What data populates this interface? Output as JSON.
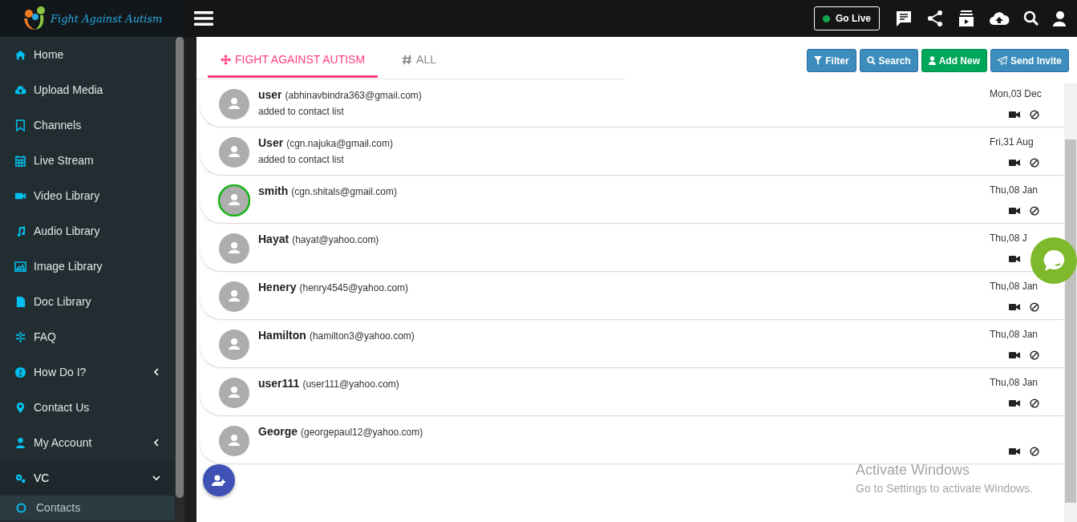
{
  "brand": {
    "name": "Fight Against Autism"
  },
  "header": {
    "go_live": "Go Live"
  },
  "sidebar": {
    "items": [
      {
        "label": "Home",
        "selected": false
      },
      {
        "label": "Upload Media",
        "selected": false
      },
      {
        "label": "Channels",
        "selected": false
      },
      {
        "label": "Live Stream",
        "selected": false
      },
      {
        "label": "Video Library",
        "selected": false
      },
      {
        "label": "Audio Library",
        "selected": false
      },
      {
        "label": "Image Library",
        "selected": false
      },
      {
        "label": "Doc Library",
        "selected": false
      },
      {
        "label": "FAQ",
        "selected": false
      },
      {
        "label": "How Do I?",
        "selected": false,
        "expanded": false
      },
      {
        "label": "Contact Us",
        "selected": false
      },
      {
        "label": "My Account",
        "selected": false,
        "expanded": false
      },
      {
        "label": "VC",
        "selected": true,
        "expanded": true,
        "children": [
          {
            "label": "Contacts",
            "selected": true
          }
        ]
      }
    ]
  },
  "tabs": [
    {
      "label": "FIGHT AGAINST AUTISM",
      "selected": true
    },
    {
      "label": "ALL",
      "selected": false
    }
  ],
  "buttons": [
    {
      "label": "Filter",
      "kind": "filter"
    },
    {
      "label": "Search",
      "kind": "search"
    },
    {
      "label": "Add New",
      "kind": "add"
    },
    {
      "label": "Send Invite",
      "kind": "invite"
    }
  ],
  "contacts": [
    {
      "name": "user",
      "email": "(abhinavbindra363@gmail.com)",
      "note": "added to contact list",
      "date": "Mon,03 Dec",
      "online": false,
      "blockable": true
    },
    {
      "name": "User",
      "email": "(cgn.najuka@gmail.com)",
      "note": "added to contact list",
      "date": "Fri,31 Aug",
      "online": false,
      "blockable": true
    },
    {
      "name": "smith",
      "email": "(cgn.shitals@gmail.com)",
      "date": "Thu,08 Jan",
      "online": true,
      "blockable": true
    },
    {
      "name": "Hayat",
      "email": "(hayat@yahoo.com)",
      "date": "Thu,08 J",
      "online": false,
      "blockable": false
    },
    {
      "name": "Henery",
      "email": "(henry4545@yahoo.com)",
      "date": "Thu,08 Jan",
      "online": false,
      "blockable": true
    },
    {
      "name": "Hamilton",
      "email": "(hamilton3@yahoo.com)",
      "date": "Thu,08 Jan",
      "online": false,
      "blockable": true
    },
    {
      "name": "user111",
      "email": "(user111@yahoo.com)",
      "date": "Thu,08 Jan",
      "online": false,
      "blockable": true
    },
    {
      "name": "George",
      "email": "(georgepaul12@yahoo.com)",
      "online": false,
      "blockable": true
    }
  ],
  "overlay": {
    "title": "Activate Windows",
    "subtitle": "Go to Settings to activate Windows."
  }
}
